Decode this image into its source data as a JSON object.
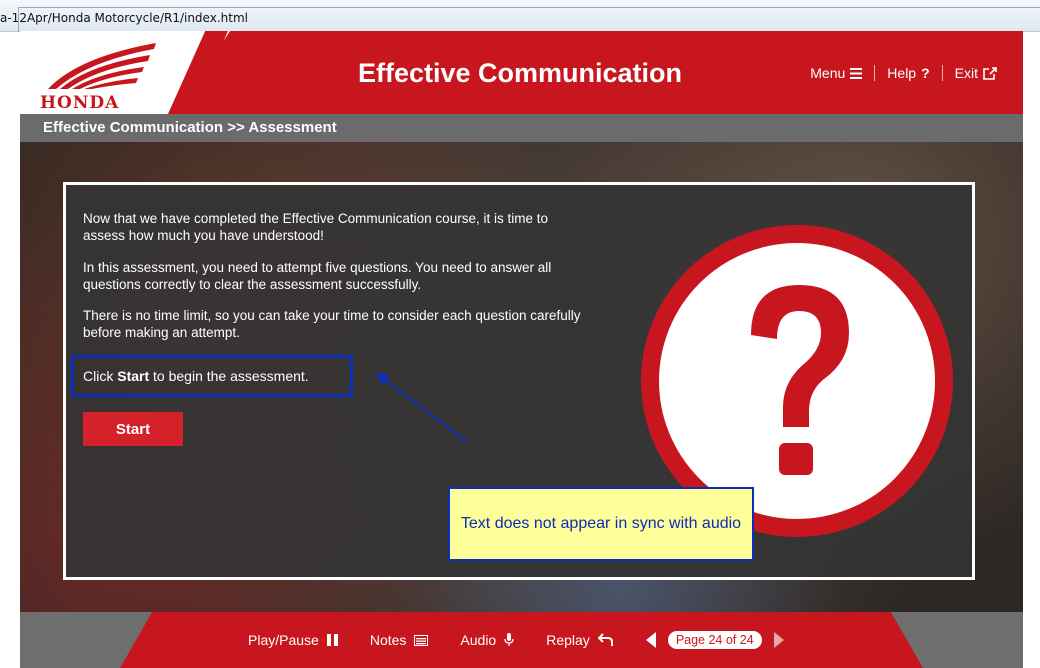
{
  "browser": {
    "address": "a-12Apr/Honda Motorcycle/R1/index.html"
  },
  "header": {
    "brand": "HONDA",
    "title": "Effective Communication",
    "nav": {
      "menu": "Menu",
      "help": "Help",
      "exit": "Exit"
    }
  },
  "breadcrumb": "Effective Communication >> Assessment",
  "content": {
    "p1": "Now that we have completed the Effective Communication course, it is time to assess how much you have understood!",
    "p2": "In this assessment, you need to attempt five questions. You need to answer all questions correctly to clear the assessment successfully.",
    "p3": "There is no time limit, so you can take your time to consider each question carefully before making an attempt.",
    "click_prefix": "Click",
    "click_bold": "Start",
    "click_suffix": "to begin the assessment.",
    "start_button": "Start",
    "callout": "Text does not appear in sync with audio"
  },
  "footer": {
    "play_pause": "Play/Pause",
    "notes": "Notes",
    "audio": "Audio",
    "replay": "Replay",
    "page": "Page 24 of 24"
  },
  "colors": {
    "brand_red": "#c8161e",
    "annotation_blue": "#0a2dbd",
    "callout_yellow": "#ffff99"
  },
  "icons": [
    "honda-wing-logo",
    "menu-icon",
    "help-icon",
    "exit-icon",
    "pause-icon",
    "notes-icon",
    "microphone-icon",
    "replay-icon",
    "prev-page-icon",
    "next-page-icon",
    "question-mark-icon"
  ]
}
